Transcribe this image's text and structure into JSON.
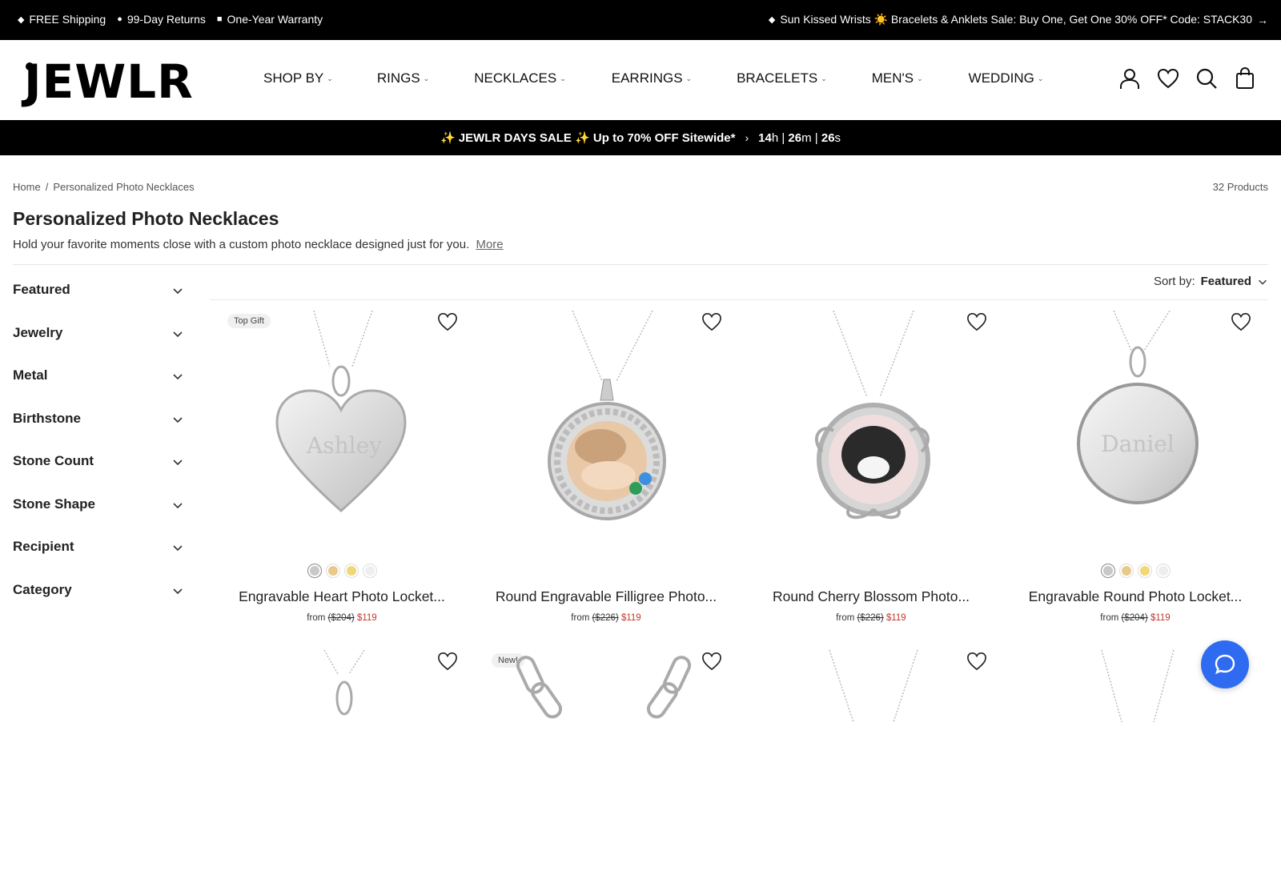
{
  "topbar": {
    "left_items": [
      {
        "glyph": "◆",
        "text": "FREE Shipping"
      },
      {
        "glyph": "●",
        "text": "99-Day Returns"
      },
      {
        "glyph": "■",
        "text": "One-Year Warranty"
      }
    ],
    "right_glyph": "◆",
    "right_text": "Sun Kissed Wrists ☀️ Bracelets & Anklets Sale: Buy One, Get One 30% OFF* Code: STACK30",
    "right_arrow": "→"
  },
  "header": {
    "logo": "JEWLR",
    "nav": [
      "SHOP BY",
      "RINGS",
      "NECKLACES",
      "EARRINGS",
      "BRACELETS",
      "MEN'S",
      "WEDDING"
    ],
    "icons": [
      "account-icon",
      "wishlist-icon",
      "search-icon",
      "cart-icon"
    ]
  },
  "salebar": {
    "text": "✨ JEWLR DAYS SALE ✨ Up to 70% OFF Sitewide*",
    "chevron": "›",
    "hours": "14",
    "hours_unit": "h",
    "minutes": "26",
    "minutes_unit": "m",
    "seconds": "26",
    "seconds_unit": "s",
    "sep": "|"
  },
  "breadcrumb": {
    "home": "Home",
    "sep": "/",
    "current": "Personalized Photo Necklaces"
  },
  "product_count": "32 Products",
  "page": {
    "title": "Personalized Photo Necklaces",
    "description": "Hold your favorite moments close with a custom photo necklace designed just for you.",
    "more": "More"
  },
  "filters": [
    "Featured",
    "Jewelry",
    "Metal",
    "Birthstone",
    "Stone Count",
    "Stone Shape",
    "Recipient",
    "Category"
  ],
  "sort": {
    "label": "Sort by:",
    "value": "Featured"
  },
  "products": [
    {
      "badge": "Top Gift",
      "title": "Engravable Heart Photo Locket...",
      "from": "from",
      "orig": "($204)",
      "price": "$119",
      "image": "heart-locket",
      "engraving": "Ashley",
      "swatches": [
        "#c8c8c8",
        "#e8c98a",
        "#f0d878",
        "#eeeeee"
      ]
    },
    {
      "badge": "",
      "title": "Round Engravable Filligree Photo...",
      "from": "from",
      "orig": "($226)",
      "price": "$119",
      "image": "filigree-photo",
      "engraving": "",
      "swatches": []
    },
    {
      "badge": "",
      "title": "Round Cherry Blossom Photo...",
      "from": "from",
      "orig": "($226)",
      "price": "$119",
      "image": "blossom-photo",
      "engraving": "",
      "swatches": []
    },
    {
      "badge": "",
      "title": "Engravable Round Photo Locket...",
      "from": "from",
      "orig": "($204)",
      "price": "$119",
      "image": "round-locket",
      "engraving": "Daniel",
      "swatches": [
        "#c8c8c8",
        "#e8c98a",
        "#f0d878",
        "#eeeeee"
      ]
    }
  ],
  "products_row2": [
    {
      "badge": ""
    },
    {
      "badge": "New!"
    },
    {
      "badge": ""
    },
    {
      "badge": ""
    }
  ],
  "colors": {
    "black": "#000000",
    "sale_red": "#c0392b",
    "chat_blue": "#2e6bf0"
  }
}
